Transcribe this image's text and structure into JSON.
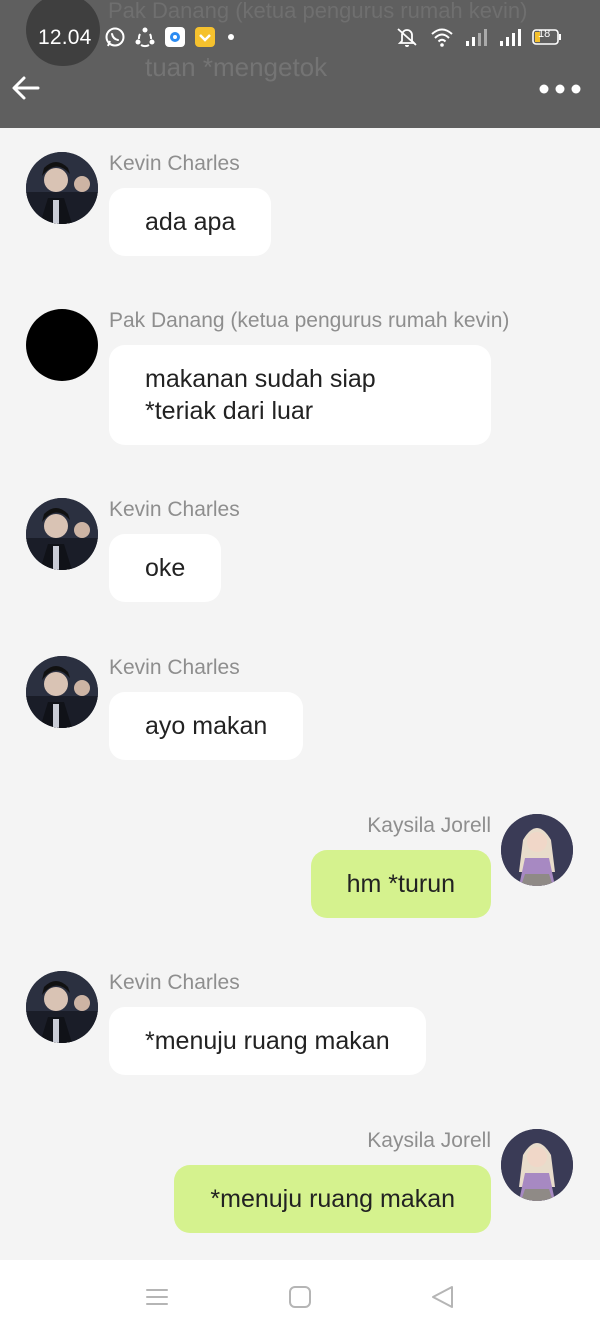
{
  "status_bar": {
    "time": "12.04",
    "battery": "18",
    "left_icons": [
      "whatsapp-icon",
      "sync-icon",
      "app-icon",
      "wallet-icon",
      "dot-icon"
    ],
    "right_icons": [
      "mute-icon",
      "wifi-icon",
      "signal-icon",
      "signal-icon",
      "battery-icon"
    ]
  },
  "header": {
    "ghost_sender": "Pak Danang (ketua pengurus rumah kevin)",
    "ghost_message": "tuan *mengetok"
  },
  "messages": [
    {
      "side": "left",
      "avatar": "kevin",
      "sender": "Kevin Charles",
      "text": "ada apa"
    },
    {
      "side": "left",
      "avatar": "black",
      "sender": "Pak Danang (ketua pengurus rumah kevin)",
      "text": "makanan sudah siap\n*teriak dari luar"
    },
    {
      "side": "left",
      "avatar": "kevin",
      "sender": "Kevin Charles",
      "text": "oke"
    },
    {
      "side": "left",
      "avatar": "kevin",
      "sender": "Kevin Charles",
      "text": "ayo makan"
    },
    {
      "side": "right",
      "avatar": "kaysila",
      "sender": "Kaysila Jorell",
      "text": "hm *turun"
    },
    {
      "side": "left",
      "avatar": "kevin",
      "sender": "Kevin Charles",
      "text": "*menuju ruang makan"
    },
    {
      "side": "right",
      "avatar": "kaysila",
      "sender": "Kaysila Jorell",
      "text": "*menuju ruang makan"
    }
  ],
  "colors": {
    "header_bg": "#5f5f5f",
    "chat_bg": "#f4f4f4",
    "bubble_incoming": "#ffffff",
    "bubble_outgoing": "#d5f28e",
    "sender_name": "#8e8e8e"
  },
  "nav": [
    "menu-icon",
    "home-icon",
    "back-triangle-icon"
  ]
}
